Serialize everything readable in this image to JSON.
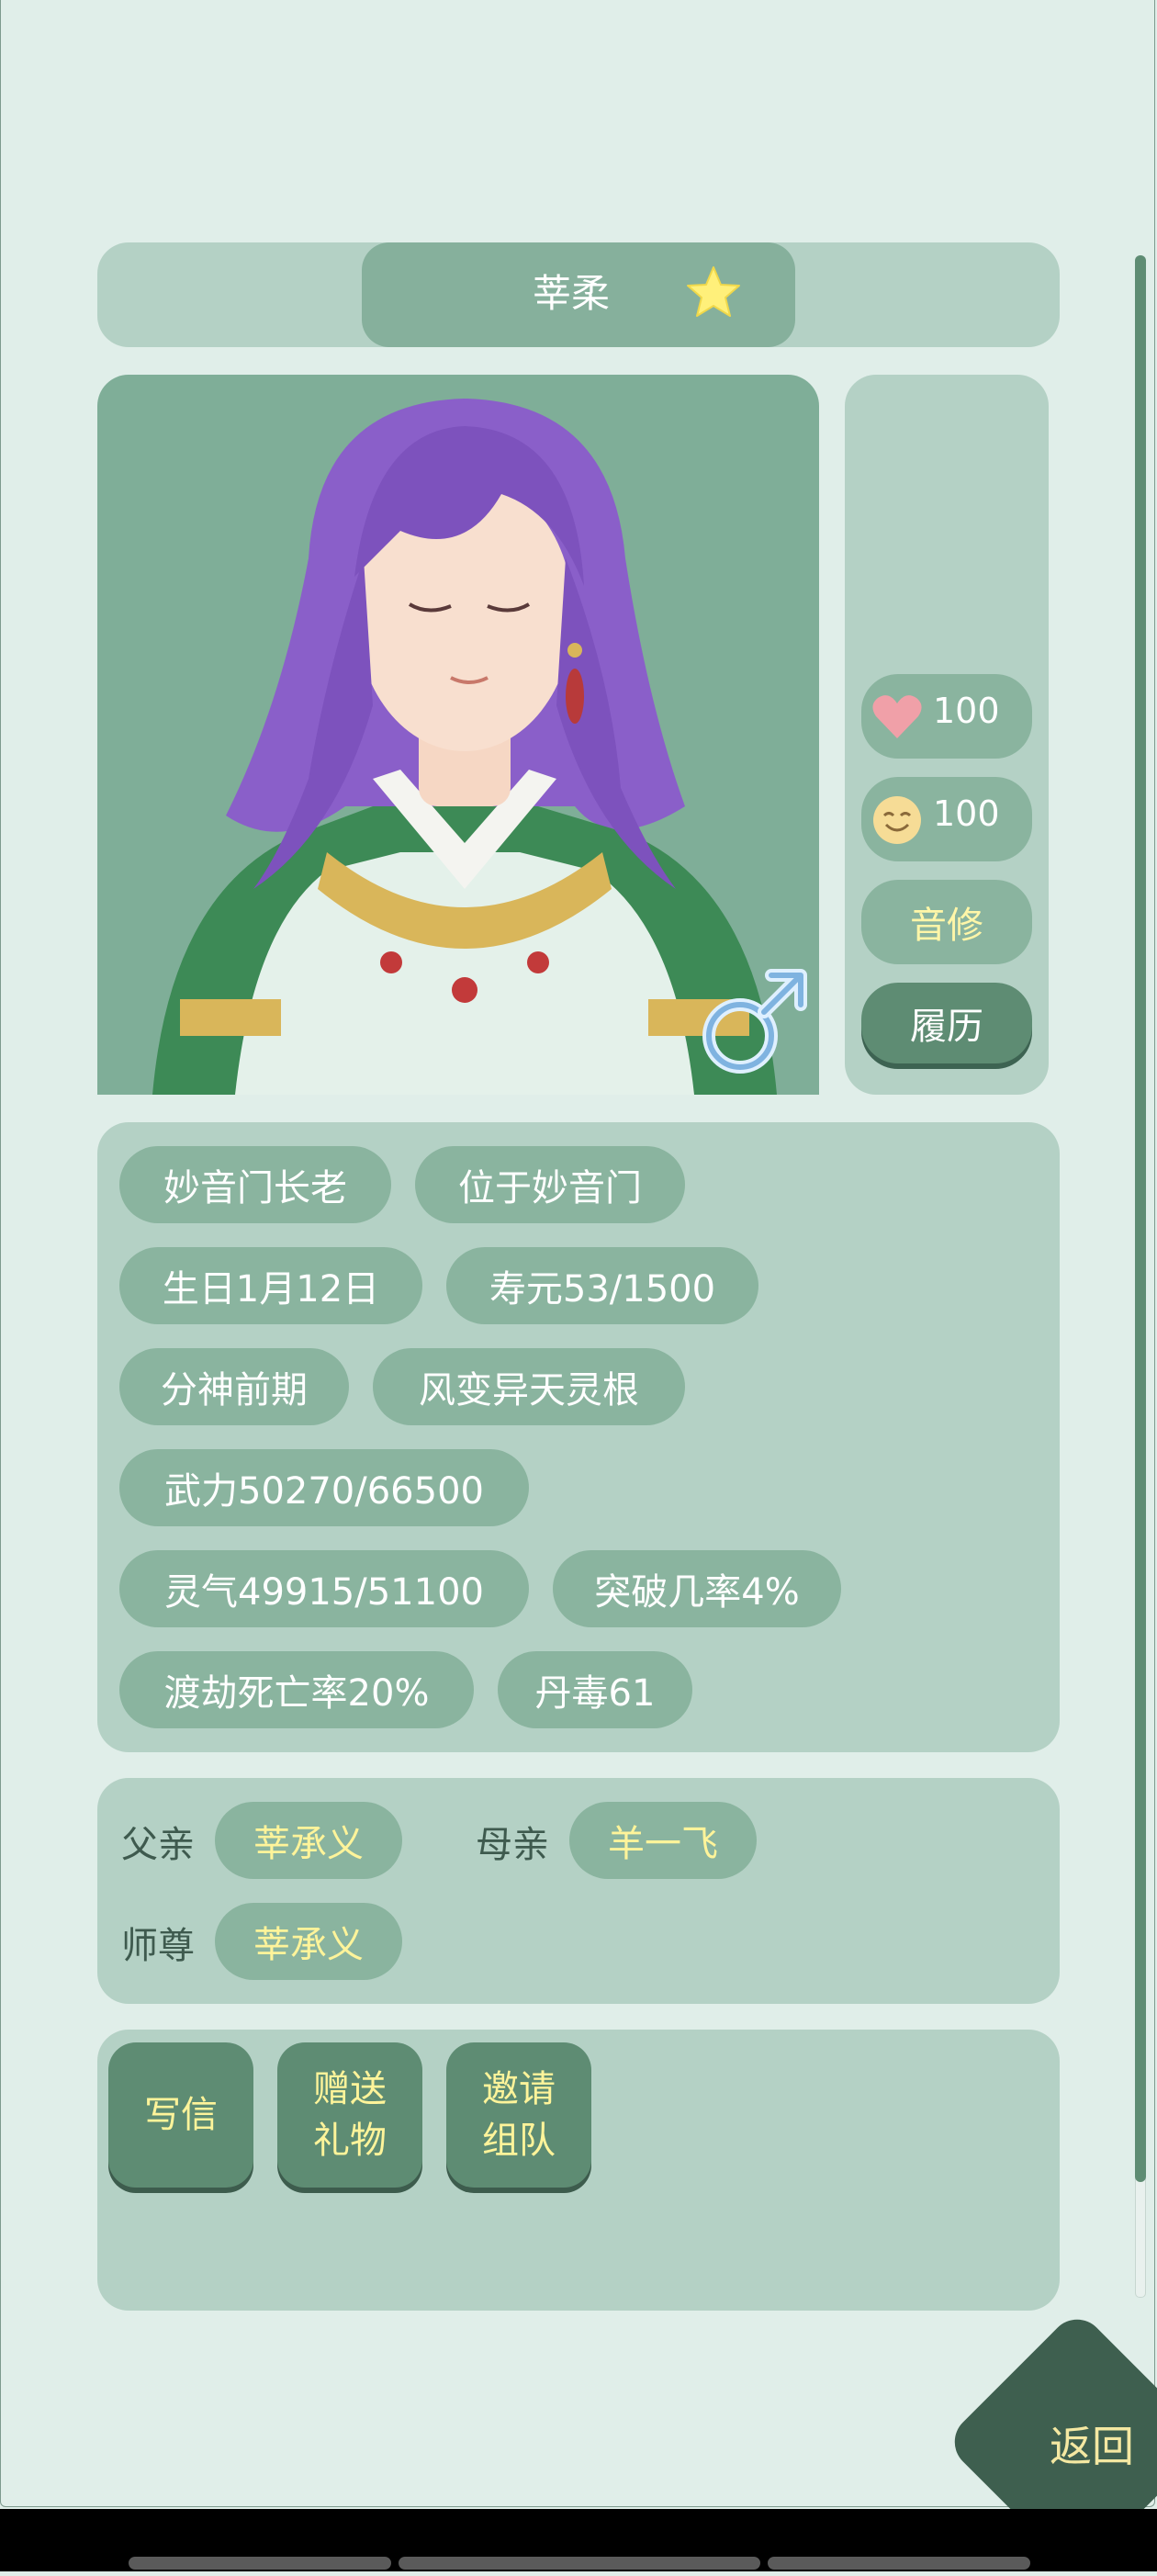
{
  "character": {
    "name": "莘柔",
    "favorite_icon": "star-icon",
    "gender_icon": "male-symbol-icon"
  },
  "side_stats": {
    "affection": {
      "icon": "heart-icon",
      "value": "100"
    },
    "mood": {
      "icon": "smile-face-icon",
      "value": "100"
    },
    "profession_label": "音修",
    "history_label": "履历"
  },
  "info_chips": [
    "妙音门长老",
    "位于妙音门",
    "生日1月12日",
    "寿元53/1500",
    "分神前期",
    "风变异天灵根",
    "武力50270/66500",
    "灵气49915/51100",
    "突破几率4%",
    "渡劫死亡率20%",
    "丹毒61"
  ],
  "relations": {
    "father_label": "父亲",
    "father_name": "莘承义",
    "mother_label": "母亲",
    "mother_name": "羊一飞",
    "master_label": "师尊",
    "master_name": "莘承义"
  },
  "actions": {
    "write_letter": "写信",
    "give_gift": "赠送\n礼物",
    "invite_team": "邀请\n组队"
  },
  "back_label": "返回",
  "colors": {
    "background": "#e0eee9",
    "panel": "#b4d1c5",
    "chip": "#8ab49f",
    "button_dark": "#5e8c73",
    "accent_yellow": "#fff49a",
    "back_button": "#3e5f4f"
  }
}
